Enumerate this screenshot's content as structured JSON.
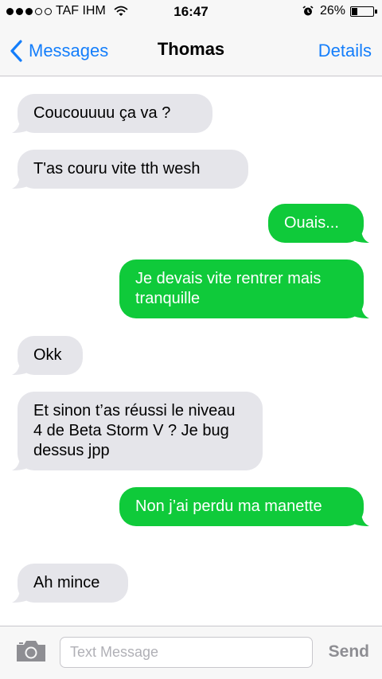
{
  "status_bar": {
    "carrier": "TAF IHM",
    "time": "16:47",
    "battery": "26%",
    "battery_level": 0.26,
    "signal_bars": 3,
    "signal_total": 5
  },
  "nav": {
    "back_label": "Messages",
    "title": "Thomas",
    "details_label": "Details",
    "accent": "#147efb"
  },
  "messages": [
    {
      "direction": "incoming",
      "text": "Coucouuuu ça va ?"
    },
    {
      "direction": "incoming",
      "text": "T'as couru vite tth wesh"
    },
    {
      "direction": "outgoing",
      "text": "Ouais..."
    },
    {
      "direction": "outgoing",
      "text": "Je devais vite rentrer mais tranquille"
    },
    {
      "direction": "incoming",
      "text": "Okk"
    },
    {
      "direction": "incoming",
      "text": "Et sinon t’as réussi le niveau 4 de Beta Storm V ? Je bug dessus jpp"
    },
    {
      "direction": "outgoing",
      "text": "Non j’ai perdu ma manette"
    },
    {
      "direction": "incoming",
      "text": "Ah mince"
    }
  ],
  "composer": {
    "placeholder": "Text Message",
    "send_label": "Send",
    "camera_icon": "camera-icon"
  },
  "colors": {
    "incoming_bubble": "#e5e5ea",
    "outgoing_bubble": "#0fca3a",
    "send_disabled": "#8e8e93"
  }
}
